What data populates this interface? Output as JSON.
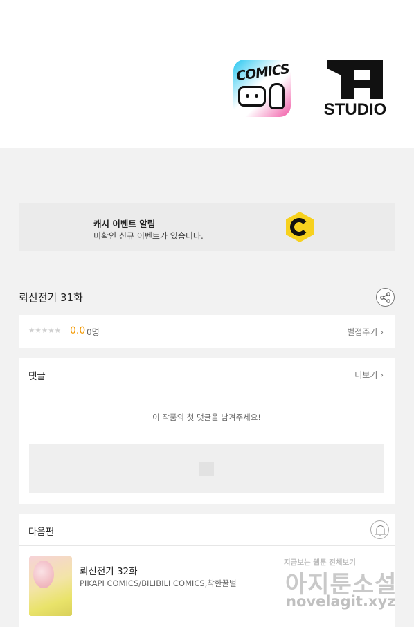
{
  "banner": {
    "comics_logo_text": "COMICS",
    "studio_logo_text": "STUDIO"
  },
  "cash_alert": {
    "title": "캐시 이벤트 알림",
    "subtitle": "미확인 신규 이벤트가 있습니다.",
    "icon": "cash-c-icon",
    "icon_color": "#f7d11e"
  },
  "episode": {
    "title": "뢰신전기 31화",
    "share_icon": "share-icon"
  },
  "rating": {
    "stars": "★★★★★",
    "score": "0.0",
    "count": "0명",
    "rate_label": "별점주기",
    "score_color": "#f39800"
  },
  "comments": {
    "header": "댓글",
    "more_label": "더보기",
    "empty_message": "이 작품의 첫 댓글을 남겨주세요!"
  },
  "next_episode": {
    "header": "다음편",
    "title": "뢰신전기 32화",
    "author": "PIKAPI COMICS/BILIBILI COMICS,착한꿀벌",
    "bell_icon": "bell-icon"
  },
  "watermark": {
    "tagline": "지금보는 웹툰 전체보기",
    "brand": "아지툰소설",
    "url": "novelagit.xyz"
  }
}
